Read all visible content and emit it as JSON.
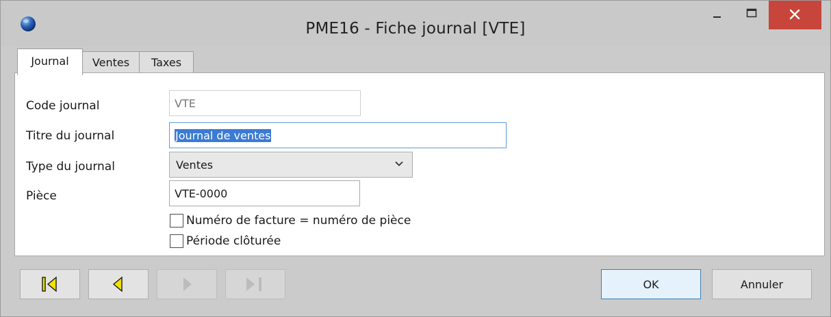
{
  "window": {
    "title": "PME16 - Fiche journal [VTE]"
  },
  "titlebar_buttons": {
    "minimize": "minimize-icon",
    "maximize": "maximize-icon",
    "close": "close-icon"
  },
  "tabs": [
    {
      "label": "Journal",
      "active": true
    },
    {
      "label": "Ventes",
      "active": false
    },
    {
      "label": "Taxes",
      "active": false
    }
  ],
  "form": {
    "code": {
      "label": "Code journal",
      "value": "VTE",
      "enabled": false
    },
    "titre": {
      "label": "Titre du journal",
      "value": "Journal de ventes"
    },
    "type": {
      "label": "Type du journal",
      "value": "Ventes"
    },
    "piece": {
      "label": "Pièce",
      "value": "VTE-0000"
    },
    "checkbox_facture": {
      "label": "Numéro de facture = numéro de pièce",
      "checked": false
    },
    "checkbox_periode": {
      "label": "Période clôturée",
      "checked": false
    }
  },
  "navigation": {
    "first": {
      "icon": "first-record-icon",
      "enabled": true
    },
    "prev": {
      "icon": "previous-record-icon",
      "enabled": true
    },
    "next": {
      "icon": "next-record-icon",
      "enabled": false
    },
    "last": {
      "icon": "last-record-icon",
      "enabled": false
    }
  },
  "buttons": {
    "ok": "OK",
    "cancel": "Annuler"
  },
  "colors": {
    "close_button": "#c7453a",
    "nav_icon": "#f2e200",
    "selection": "#3a7bd5",
    "focus_border": "#5c9cd8"
  }
}
